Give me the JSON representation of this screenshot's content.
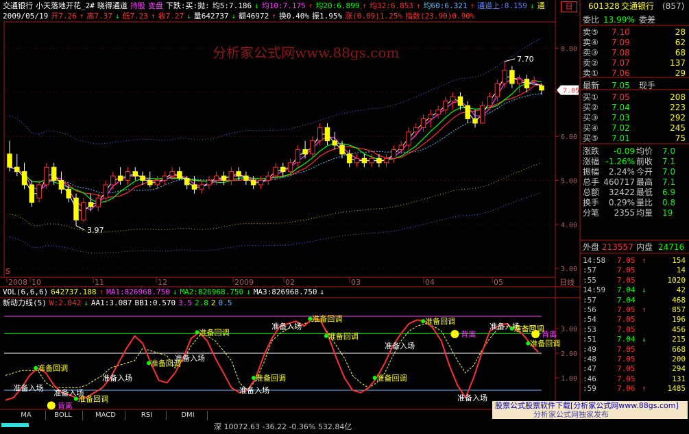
{
  "header": {
    "line1": [
      {
        "text": "交通银行",
        "color": "#ffffff"
      },
      {
        "text": "小天落地开花_2#",
        "color": "#ffffff"
      },
      {
        "text": "晓得通道",
        "color": "#ffffff"
      },
      {
        "text": "持股",
        "color": "#ff3cff"
      },
      {
        "text": "变盘",
        "color": "#ff3cff"
      },
      {
        "text": "下跌:买:抛:",
        "color": "#ffffff"
      },
      {
        "text": "均5:7.186",
        "color": "#ffffff"
      },
      {
        "text": "↓",
        "color": "#00ff00"
      },
      {
        "text": "均10:7.175",
        "color": "#ff3cff"
      },
      {
        "text": "↑",
        "color": "#ff3030"
      },
      {
        "text": "均20:6.899",
        "color": "#00ff00"
      },
      {
        "text": "↑",
        "color": "#ff3030"
      },
      {
        "text": "均32:6.853",
        "color": "#ff3030"
      },
      {
        "text": "↑",
        "color": "#ff3030"
      },
      {
        "text": "均60:6.321",
        "color": "#60c0ff"
      },
      {
        "text": "↑",
        "color": "#ff3030"
      },
      {
        "text": "通道上:8.159",
        "color": "#6080ff"
      },
      {
        "text": "↓",
        "color": "#00ff00"
      },
      {
        "text": "通",
        "color": "#ffff00"
      }
    ],
    "line2": [
      {
        "text": "2009/05/19",
        "color": "#ffffff"
      },
      {
        "text": "开7.26",
        "color": "#ff3030"
      },
      {
        "text": "↑",
        "color": "#ff3030"
      },
      {
        "text": "高7.37",
        "color": "#ff3030"
      },
      {
        "text": "↓",
        "color": "#00ff00"
      },
      {
        "text": "低7.23",
        "color": "#ff3030"
      },
      {
        "text": "↑",
        "color": "#ff3030"
      },
      {
        "text": "收7.27",
        "color": "#ff3030"
      },
      {
        "text": "↓",
        "color": "#00ff00"
      },
      {
        "text": "量642737",
        "color": "#ffffff"
      },
      {
        "text": "↓",
        "color": "#00ff00"
      },
      {
        "text": "额46972",
        "color": "#ffffff"
      },
      {
        "text": "↑",
        "color": "#ff3030"
      },
      {
        "text": "换0.40%",
        "color": "#ffffff"
      },
      {
        "text": "振1.95%",
        "color": "#ffffff"
      },
      {
        "text": "涨(0.09)1.25%",
        "color": "#ff3030"
      },
      {
        "text": "指数(23.90)0.90%",
        "color": "#ff3030"
      }
    ],
    "badge": "日"
  },
  "watermark": "分析家公式网www.88gs.com",
  "vol_line": [
    {
      "text": "VOL(6,6,6)",
      "color": "#ffffff"
    },
    {
      "text": "642737.188",
      "color": "#ffff00"
    },
    {
      "text": "↑",
      "color": "#ff3030"
    },
    {
      "text": "MA1:826968.750",
      "color": "#ff3cff"
    },
    {
      "text": "↓",
      "color": "#00ff00"
    },
    {
      "text": "MA2:826968.750",
      "color": "#00ff00"
    },
    {
      "text": "↓",
      "color": "#00ff00"
    },
    {
      "text": "MA3:826968.750",
      "color": "#ffffff"
    },
    {
      "text": "↓",
      "color": "#ffffff"
    }
  ],
  "ind_line": [
    {
      "text": "新动力线(5)",
      "color": "#ffffff"
    },
    {
      "text": "W:2.042",
      "color": "#ff3030"
    },
    {
      "text": "↓",
      "color": "#00ff00"
    },
    {
      "text": "AA1:3.087",
      "color": "#ffffff"
    },
    {
      "text": "BB1:0.570",
      "color": "#ffffff"
    },
    {
      "text": "3.5",
      "color": "#ff3cff"
    },
    {
      "text": "2.8",
      "color": "#00ff00"
    },
    {
      "text": "2",
      "color": "#ffff00"
    },
    {
      "text": "0.5",
      "color": "#60c0ff"
    }
  ],
  "date_axis": {
    "labels": [
      "2008",
      "10",
      "11",
      "12",
      "2009",
      "02",
      "03",
      "04",
      "05"
    ],
    "right_label": "日线"
  },
  "price_callouts": {
    "high": "7.70",
    "low": "3.97",
    "current": "7.05",
    "s_mark": "S"
  },
  "signals": {
    "entry": "准备入场",
    "pullback": "准备回调",
    "divergence": "背离"
  },
  "tabs": [
    "MA",
    "BOLL",
    "MACD",
    "RSI",
    "DMI"
  ],
  "bottom_bar": {
    "index_text": "深 10072.63 -36.22 -0.36% 532.84亿",
    "ad_text": "股票公式股票软件下载[分析家公式网www.88gs.com]",
    "ad_tail": "分析家公式网独家发布"
  },
  "quote": {
    "code": "601328",
    "name": "交通银行",
    "suffix": "(857)",
    "weibi_label": "委比",
    "weibi_value": "13.99%",
    "weicha_label": "委差",
    "asks": [
      {
        "label": "卖⑤",
        "price": "7.10",
        "vol": "28"
      },
      {
        "label": "卖④",
        "price": "7.09",
        "vol": "62"
      },
      {
        "label": "卖③",
        "price": "7.08",
        "vol": "68"
      },
      {
        "label": "卖②",
        "price": "7.07",
        "vol": "137"
      },
      {
        "label": "卖①",
        "price": "7.06",
        "vol": "29"
      }
    ],
    "last_label": "最新",
    "last_price": "7.05",
    "hand_label": "现手",
    "bids": [
      {
        "label": "买①",
        "price": "7.05",
        "vol": "208"
      },
      {
        "label": "买②",
        "price": "7.04",
        "vol": "223"
      },
      {
        "label": "买③",
        "price": "7.03",
        "vol": "292"
      },
      {
        "label": "买④",
        "price": "7.02",
        "vol": "245"
      },
      {
        "label": "买⑤",
        "price": "7.01",
        "vol": "75"
      }
    ],
    "stats": [
      {
        "l1": "涨跌",
        "v1": "-0.09",
        "l2": "均价",
        "v2": "7.0"
      },
      {
        "l1": "涨幅",
        "v1": "-1.26%",
        "l2": "前收",
        "v2": "7.1"
      },
      {
        "l1": "振幅",
        "v1": "2.24%",
        "l2": "今开",
        "v2": "7.0"
      },
      {
        "l1": "总手",
        "v1": "460717",
        "l2": "最高",
        "v2": "7.1"
      },
      {
        "l1": "总额",
        "v1": "32422",
        "l2": "最低",
        "v2": "6.9"
      },
      {
        "l1": "换手",
        "v1": "0.29%",
        "l2": "量比",
        "v2": "0.8"
      },
      {
        "l1": "分笔",
        "v1": "2355",
        "l2": "均量",
        "v2": "19"
      }
    ],
    "outer_label": "外盘",
    "outer_value": "213557",
    "inner_label": "内盘",
    "inner_value": "24716"
  },
  "ticks": [
    {
      "t": "14:58",
      "p": "7.05",
      "d": "↑",
      "v": "154"
    },
    {
      "t": ":57",
      "p": "7.05",
      "d": "",
      "v": "14"
    },
    {
      "t": ":55",
      "p": "7.05",
      "d": "",
      "v": "1020"
    },
    {
      "t": "14:59",
      "p": "7.04",
      "d": "↓",
      "v": "42"
    },
    {
      "t": ":57",
      "p": "7.04",
      "d": "",
      "v": "468"
    },
    {
      "t": ":56",
      "p": "7.05",
      "d": "↑",
      "v": "857"
    },
    {
      "t": ":54",
      "p": "7.05",
      "d": "",
      "v": "196"
    },
    {
      "t": ":53",
      "p": "7.05",
      "d": "",
      "v": "456"
    },
    {
      "t": ":51",
      "p": "7.04",
      "d": "↓",
      "v": "215"
    },
    {
      "t": ":49",
      "p": "7.05",
      "d": "",
      "v": "668"
    },
    {
      "t": ":48",
      "p": "7.05",
      "d": "",
      "v": "200"
    },
    {
      "t": ":47",
      "p": "7.05",
      "d": "",
      "v": "294"
    },
    {
      "t": ":46",
      "p": "7.05",
      "d": "",
      "v": "131"
    },
    {
      "t": ":59",
      "p": "7.06",
      "d": "↑",
      "v": "1485"
    }
  ],
  "colors": {
    "up": "#ff3030",
    "down": "#00ff00",
    "ma5": "#ffffff",
    "ma10": "#ff3cff",
    "ma20": "#00ff00",
    "ma32": "#ff3030",
    "ma60": "#60c0ff",
    "channel": "#6070ff",
    "axis": "#b01818",
    "label": "#b06060",
    "signal_entry": "#ffffff",
    "signal_pullback": "#ffff00"
  },
  "chart_data": [
    {
      "type": "candlestick",
      "title": "交通银行 日线",
      "ylim": [
        2.8,
        8.6
      ],
      "y_ticks": [
        3.0,
        4.0,
        5.0,
        6.0,
        7.0,
        8.0
      ],
      "x_ticks": [
        "2008",
        "10",
        "11",
        "12",
        "2009",
        "02",
        "03",
        "04",
        "05"
      ],
      "annotations": [
        {
          "label": "7.70",
          "kind": "high"
        },
        {
          "label": "3.97",
          "kind": "low"
        }
      ],
      "series_ma": [
        {
          "name": "均5",
          "value": 7.186
        },
        {
          "name": "均10",
          "value": 7.175
        },
        {
          "name": "均20",
          "value": 6.899
        },
        {
          "name": "均32",
          "value": 6.853
        },
        {
          "name": "均60",
          "value": 6.321
        }
      ],
      "ohlc": [
        [
          5.6,
          5.9,
          5.2,
          5.3
        ],
        [
          5.3,
          5.6,
          5.1,
          5.2
        ],
        [
          5.2,
          5.4,
          4.8,
          4.9
        ],
        [
          4.9,
          5.0,
          4.4,
          4.5
        ],
        [
          4.6,
          5.0,
          4.5,
          4.9
        ],
        [
          4.9,
          5.4,
          4.8,
          5.3
        ],
        [
          5.3,
          5.4,
          4.9,
          5.0
        ],
        [
          5.0,
          5.2,
          4.7,
          4.8
        ],
        [
          4.8,
          4.9,
          4.5,
          4.6
        ],
        [
          4.6,
          4.7,
          3.97,
          4.1
        ],
        [
          4.1,
          4.6,
          4.05,
          4.5
        ],
        [
          4.5,
          4.7,
          4.3,
          4.4
        ],
        [
          4.4,
          4.7,
          4.3,
          4.6
        ],
        [
          4.6,
          5.0,
          4.5,
          4.9
        ],
        [
          4.9,
          5.2,
          4.8,
          5.1
        ],
        [
          5.1,
          5.3,
          4.9,
          5.0
        ],
        [
          5.0,
          5.3,
          4.9,
          5.2
        ],
        [
          5.2,
          5.3,
          5.0,
          5.1
        ],
        [
          5.1,
          5.2,
          4.9,
          5.0
        ],
        [
          5.0,
          5.2,
          4.85,
          4.9
        ],
        [
          4.9,
          5.1,
          4.8,
          5.0
        ],
        [
          5.0,
          5.2,
          4.9,
          5.1
        ],
        [
          5.1,
          5.3,
          5.0,
          5.2
        ],
        [
          5.2,
          5.3,
          5.0,
          5.05
        ],
        [
          5.05,
          5.1,
          4.8,
          4.9
        ],
        [
          4.9,
          5.1,
          4.7,
          4.8
        ],
        [
          4.8,
          5.0,
          4.7,
          4.9
        ],
        [
          4.9,
          5.1,
          4.8,
          5.0
        ],
        [
          5.0,
          5.2,
          4.9,
          5.1
        ],
        [
          5.1,
          5.2,
          4.9,
          5.0
        ],
        [
          5.0,
          5.3,
          4.9,
          5.2
        ],
        [
          5.2,
          5.3,
          5.0,
          5.1
        ],
        [
          5.1,
          5.2,
          4.9,
          5.0
        ],
        [
          5.0,
          5.1,
          4.8,
          4.9
        ],
        [
          4.9,
          5.1,
          4.8,
          5.0
        ],
        [
          5.0,
          5.2,
          4.9,
          5.1
        ],
        [
          5.1,
          5.4,
          5.0,
          5.3
        ],
        [
          5.3,
          5.4,
          5.1,
          5.2
        ],
        [
          5.2,
          5.5,
          5.1,
          5.4
        ],
        [
          5.4,
          5.8,
          5.3,
          5.7
        ],
        [
          5.7,
          5.9,
          5.5,
          5.6
        ],
        [
          5.6,
          6.0,
          5.5,
          5.9
        ],
        [
          5.9,
          6.3,
          5.8,
          6.2
        ],
        [
          6.2,
          6.3,
          5.8,
          5.9
        ],
        [
          5.9,
          6.1,
          5.7,
          5.8
        ],
        [
          5.8,
          5.9,
          5.5,
          5.6
        ],
        [
          5.6,
          5.7,
          5.3,
          5.4
        ],
        [
          5.4,
          5.6,
          5.3,
          5.5
        ],
        [
          5.5,
          5.6,
          5.3,
          5.4
        ],
        [
          5.4,
          5.6,
          5.3,
          5.5
        ],
        [
          5.5,
          5.6,
          5.3,
          5.4
        ],
        [
          5.4,
          5.6,
          5.3,
          5.5
        ],
        [
          5.5,
          5.8,
          5.4,
          5.7
        ],
        [
          5.7,
          5.9,
          5.6,
          5.8
        ],
        [
          5.8,
          6.2,
          5.7,
          6.1
        ],
        [
          6.1,
          6.3,
          6.0,
          6.2
        ],
        [
          6.2,
          6.5,
          6.1,
          6.4
        ],
        [
          6.4,
          6.6,
          6.2,
          6.5
        ],
        [
          6.5,
          6.7,
          6.4,
          6.6
        ],
        [
          6.6,
          6.9,
          6.5,
          6.8
        ],
        [
          6.8,
          7.0,
          6.6,
          6.9
        ],
        [
          6.9,
          7.0,
          6.6,
          6.7
        ],
        [
          6.7,
          6.8,
          6.3,
          6.4
        ],
        [
          6.4,
          6.6,
          6.2,
          6.3
        ],
        [
          6.3,
          6.8,
          6.3,
          6.7
        ],
        [
          6.7,
          7.0,
          6.6,
          6.9
        ],
        [
          6.9,
          7.3,
          6.8,
          7.2
        ],
        [
          7.2,
          7.7,
          7.1,
          7.5
        ],
        [
          7.5,
          7.6,
          7.1,
          7.2
        ],
        [
          7.2,
          7.4,
          7.0,
          7.3
        ],
        [
          7.3,
          7.4,
          7.0,
          7.1
        ],
        [
          7.26,
          7.37,
          7.23,
          7.27
        ],
        [
          7.15,
          7.2,
          6.95,
          7.05
        ]
      ]
    },
    {
      "type": "bar",
      "title": "VOL(6,6,6)",
      "values": [
        642737.188
      ],
      "series": [
        {
          "name": "MA1",
          "values": [
            826968.75
          ]
        },
        {
          "name": "MA2",
          "values": [
            826968.75
          ]
        },
        {
          "name": "MA3",
          "values": [
            826968.75
          ]
        }
      ]
    },
    {
      "type": "line",
      "title": "新动力线(5)",
      "ylim": [
        0,
        3.5
      ],
      "y_ticks": [
        1.0,
        2.0,
        3.0
      ],
      "reference_lines": [
        3.5,
        2.8,
        2,
        0.5
      ],
      "series": [
        {
          "name": "W",
          "values": [
            0.1,
            0.2,
            0.6,
            1.1,
            1.4,
            1.2,
            0.7,
            0.4,
            0.3,
            0.15,
            0.2,
            0.4,
            0.6,
            1.0,
            1.6,
            2.2,
            2.7,
            2.4,
            1.6,
            0.9,
            0.8,
            1.2,
            1.8,
            2.6,
            2.85,
            2.5,
            1.8,
            1.2,
            0.6,
            0.4,
            0.5,
            1.0,
            1.9,
            2.6,
            3.1,
            3.2,
            3.3,
            3.1,
            3.4,
            3.35,
            2.7,
            1.8,
            1.0,
            0.5,
            0.4,
            0.6,
            1.0,
            1.6,
            2.3,
            2.8,
            3.2,
            3.35,
            3.3,
            3.0,
            2.5,
            1.5,
            0.7,
            0.2,
            1.0,
            2.0,
            2.9,
            3.1,
            3.2,
            3.0,
            2.8,
            2.4,
            2.042
          ]
        },
        {
          "name": "AA1",
          "values": [
            1.1,
            1.2,
            1.3,
            1.3,
            1.3,
            0.8,
            0.6,
            0.6,
            0.6,
            0.6,
            0.7,
            0.9,
            1.1,
            1.4,
            1.5,
            1.6,
            1.7,
            2.2,
            2.1,
            2.0,
            1.9,
            1.4,
            1.7,
            2.3,
            2.7,
            2.7,
            2.5,
            2.1,
            1.7,
            0.8,
            0.5,
            0.9,
            1.6,
            2.5,
            2.8,
            3.0,
            3.1,
            3.2,
            3.3,
            3.3,
            2.8,
            2.3,
            1.8,
            1.1,
            0.8,
            0.6,
            0.8,
            1.2,
            1.9,
            2.5,
            2.9,
            3.1,
            3.2,
            3.1,
            2.9,
            2.3,
            1.7,
            1.2,
            1.5,
            2.1,
            2.6,
            3.0,
            3.087,
            3.087,
            3.087,
            3.087,
            3.087
          ]
        }
      ]
    }
  ]
}
